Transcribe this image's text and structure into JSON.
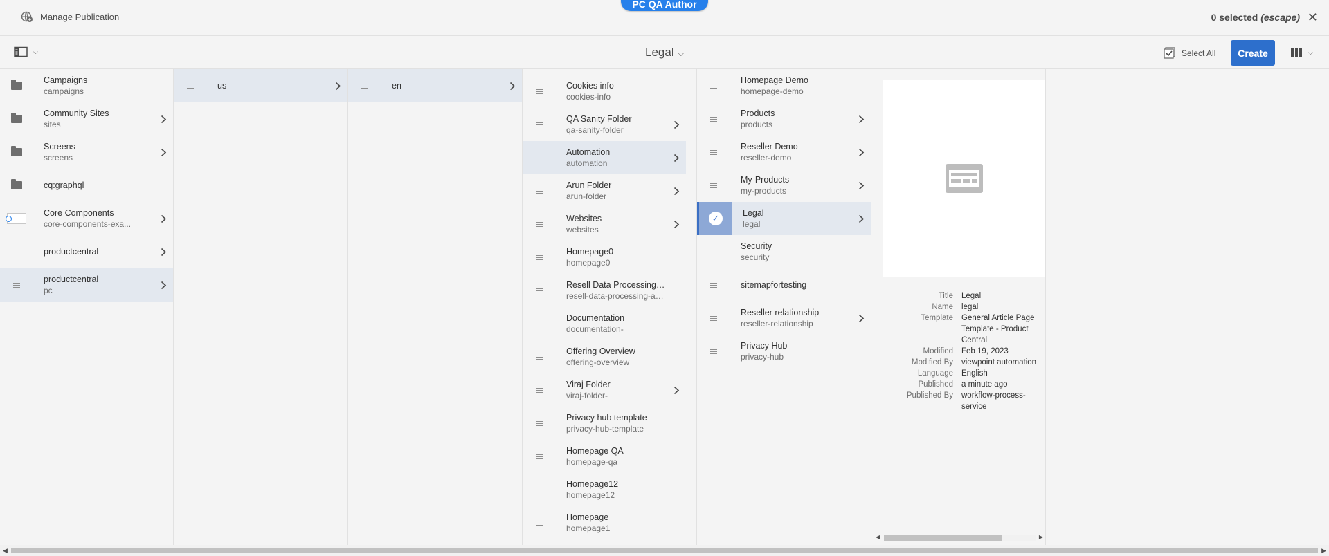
{
  "header": {
    "environment_badge": "PC QA Author",
    "manage_publication": "Manage Publication",
    "selected_count": "0 selected",
    "selected_hint": "(escape)"
  },
  "toolbar": {
    "title": "Legal",
    "select_all": "Select All",
    "create": "Create"
  },
  "column1": {
    "items": [
      {
        "title": "Campaigns",
        "name": "campaigns",
        "icon": "folder-icon",
        "has_children": false
      },
      {
        "title": "Community Sites",
        "name": "sites",
        "icon": "folder-icon",
        "has_children": true
      },
      {
        "title": "Screens",
        "name": "screens",
        "icon": "folder-icon",
        "has_children": true
      },
      {
        "title": "cq:graphql",
        "name": "",
        "icon": "folder-icon",
        "has_children": false
      },
      {
        "title": "Core Components",
        "name": "core-components-exa...",
        "icon": "component-icon",
        "has_children": true
      },
      {
        "title": "productcentral",
        "name": "",
        "icon": "page-icon",
        "has_children": true
      },
      {
        "title": "productcentral",
        "name": "pc",
        "icon": "page-icon",
        "has_children": true,
        "active": true
      }
    ]
  },
  "column2": {
    "items": [
      {
        "title": "us",
        "active": true,
        "has_children": true
      }
    ]
  },
  "column3": {
    "items": [
      {
        "title": "en",
        "active": true,
        "has_children": true
      }
    ]
  },
  "column4": {
    "partial_top": "search-results",
    "items": [
      {
        "title": "Cookies info",
        "name": "cookies-info",
        "has_children": false
      },
      {
        "title": "QA Sanity Folder",
        "name": "qa-sanity-folder",
        "has_children": true
      },
      {
        "title": "Automation",
        "name": "automation",
        "has_children": true,
        "active": true
      },
      {
        "title": "Arun Folder",
        "name": "arun-folder",
        "has_children": true
      },
      {
        "title": "Websites",
        "name": "websites",
        "has_children": true
      },
      {
        "title": "Homepage0",
        "name": "homepage0",
        "has_children": false
      },
      {
        "title": "Resell Data Processing Add...",
        "name": "resell-data-processing-add...",
        "has_children": false
      },
      {
        "title": "Documentation",
        "name": "documentation-",
        "has_children": false
      },
      {
        "title": "Offering Overview",
        "name": "offering-overview",
        "has_children": false
      },
      {
        "title": "Viraj Folder",
        "name": "viraj-folder-",
        "has_children": true
      },
      {
        "title": "Privacy hub template",
        "name": "privacy-hub-template",
        "has_children": false
      },
      {
        "title": "Homepage QA",
        "name": "homepage-qa",
        "has_children": false
      },
      {
        "title": "Homepage12",
        "name": "homepage12",
        "has_children": false
      },
      {
        "title": "Homepage",
        "name": "homepage1",
        "has_children": false
      }
    ]
  },
  "column5": {
    "items": [
      {
        "title": "Homepage Demo",
        "name": "homepage-demo",
        "has_children": false
      },
      {
        "title": "Products",
        "name": "products",
        "has_children": true
      },
      {
        "title": "Reseller Demo",
        "name": "reseller-demo",
        "has_children": true
      },
      {
        "title": "My-Products",
        "name": "my-products",
        "has_children": true
      },
      {
        "title": "Legal",
        "name": "legal",
        "has_children": true,
        "selected": true
      },
      {
        "title": "Security",
        "name": "security",
        "has_children": false
      },
      {
        "title": "sitemapfortesting",
        "name": "",
        "has_children": false
      },
      {
        "title": "Reseller relationship",
        "name": "reseller-relationship",
        "has_children": true
      },
      {
        "title": "Privacy Hub",
        "name": "privacy-hub",
        "has_children": false
      }
    ]
  },
  "preview": {
    "meta": [
      {
        "key": "Title",
        "value": "Legal"
      },
      {
        "key": "Name",
        "value": "legal"
      },
      {
        "key": "Template",
        "value": "General Article Page Template - Product Central"
      },
      {
        "key": "Modified",
        "value": "Feb 19, 2023"
      },
      {
        "key": "Modified By",
        "value": "viewpoint automation"
      },
      {
        "key": "Language",
        "value": "English"
      },
      {
        "key": "Published",
        "value": "a minute ago"
      },
      {
        "key": "Published By",
        "value": "workflow-process-service"
      }
    ]
  },
  "colors": {
    "accent": "#2680eb",
    "create_button": "#2d6fcc",
    "active_row": "#e3e8ef"
  }
}
